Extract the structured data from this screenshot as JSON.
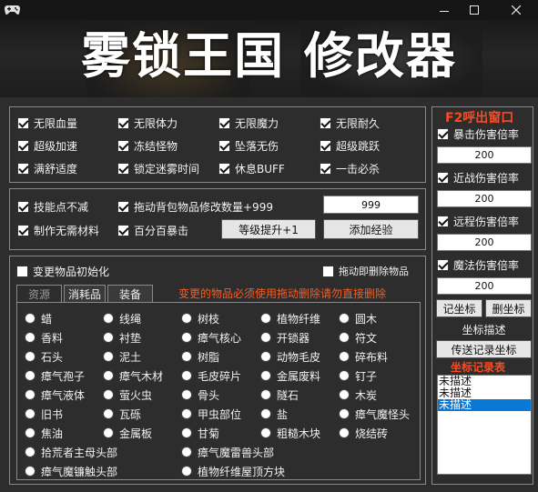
{
  "window": {
    "min_icon": "minimize-icon",
    "max_icon": "maximize-icon",
    "close_icon": "close-icon"
  },
  "banner": {
    "title": "雾锁王国  修改器"
  },
  "cheats": [
    {
      "label": "无限血量",
      "checked": true
    },
    {
      "label": "无限体力",
      "checked": true
    },
    {
      "label": "无限魔力",
      "checked": true
    },
    {
      "label": "无限耐久",
      "checked": true
    },
    {
      "label": "超级加速",
      "checked": true
    },
    {
      "label": "冻结怪物",
      "checked": true
    },
    {
      "label": "坠落无伤",
      "checked": true
    },
    {
      "label": "超级跳跃",
      "checked": true
    },
    {
      "label": "满舒适度",
      "checked": true
    },
    {
      "label": "锁定迷雾时间",
      "checked": true
    },
    {
      "label": "休息BUFF",
      "checked": true
    },
    {
      "label": "一击必杀",
      "checked": true
    }
  ],
  "skills": {
    "no_skill_cost": "技能点不减",
    "drag_modify": "拖动背包物品修改数量+999",
    "drag_value": "999",
    "no_materials": "制作无需材料",
    "full_crit": "百分百暴击",
    "level_up_button": "等级提升+1",
    "add_exp_button": "添加经验"
  },
  "items": {
    "init_label": "变更物品初始化",
    "drag_delete_label": "拖动即删除物品",
    "note": "变更的物品必须使用拖动删除请勿直接删除",
    "tabs": [
      "资源",
      "消耗品",
      "装备"
    ],
    "options": [
      "蜡",
      "线绳",
      "树枝",
      "植物纤维",
      "圆木",
      "香料",
      "衬垫",
      "瘴气核心",
      "开锁器",
      "符文",
      "石头",
      "泥土",
      "树脂",
      "动物毛皮",
      "碎布料",
      "瘴气孢子",
      "瘴气木材",
      "毛皮碎片",
      "金属废料",
      "钉子",
      "瘴气液体",
      "萤火虫",
      "骨头",
      "隧石",
      "木炭",
      "旧书",
      "瓦砾",
      "甲虫部位",
      "盐",
      "瘴气魔怪头",
      "焦油",
      "金属板",
      "甘菊",
      "粗糙木块",
      "烧结砖",
      "拾荒者主母头部",
      "瘴气魔雷兽头部",
      "瘴气魔镰触头部",
      "植物纤维屋顶方块"
    ]
  },
  "sidebar": {
    "hotkey_title": "F2呼出窗口",
    "multipliers": [
      {
        "label": "暴击伤害倍率",
        "value": "200",
        "checked": true
      },
      {
        "label": "近战伤害倍率",
        "value": "200",
        "checked": true
      },
      {
        "label": "远程伤害倍率",
        "value": "200",
        "checked": true
      },
      {
        "label": "魔法伤害倍率",
        "value": "200",
        "checked": true
      }
    ],
    "record_button": "记坐标",
    "delete_button": "删坐标",
    "describe_button": "坐标描述",
    "teleport_button": "传送记录坐标",
    "records_title": "坐标记录表",
    "records": [
      "未描述",
      "未描述",
      "未描述"
    ]
  },
  "colors": {
    "accent": "#ff4a1f",
    "selection": "#0a78d7",
    "panel_bg": "#2d2d2d"
  }
}
